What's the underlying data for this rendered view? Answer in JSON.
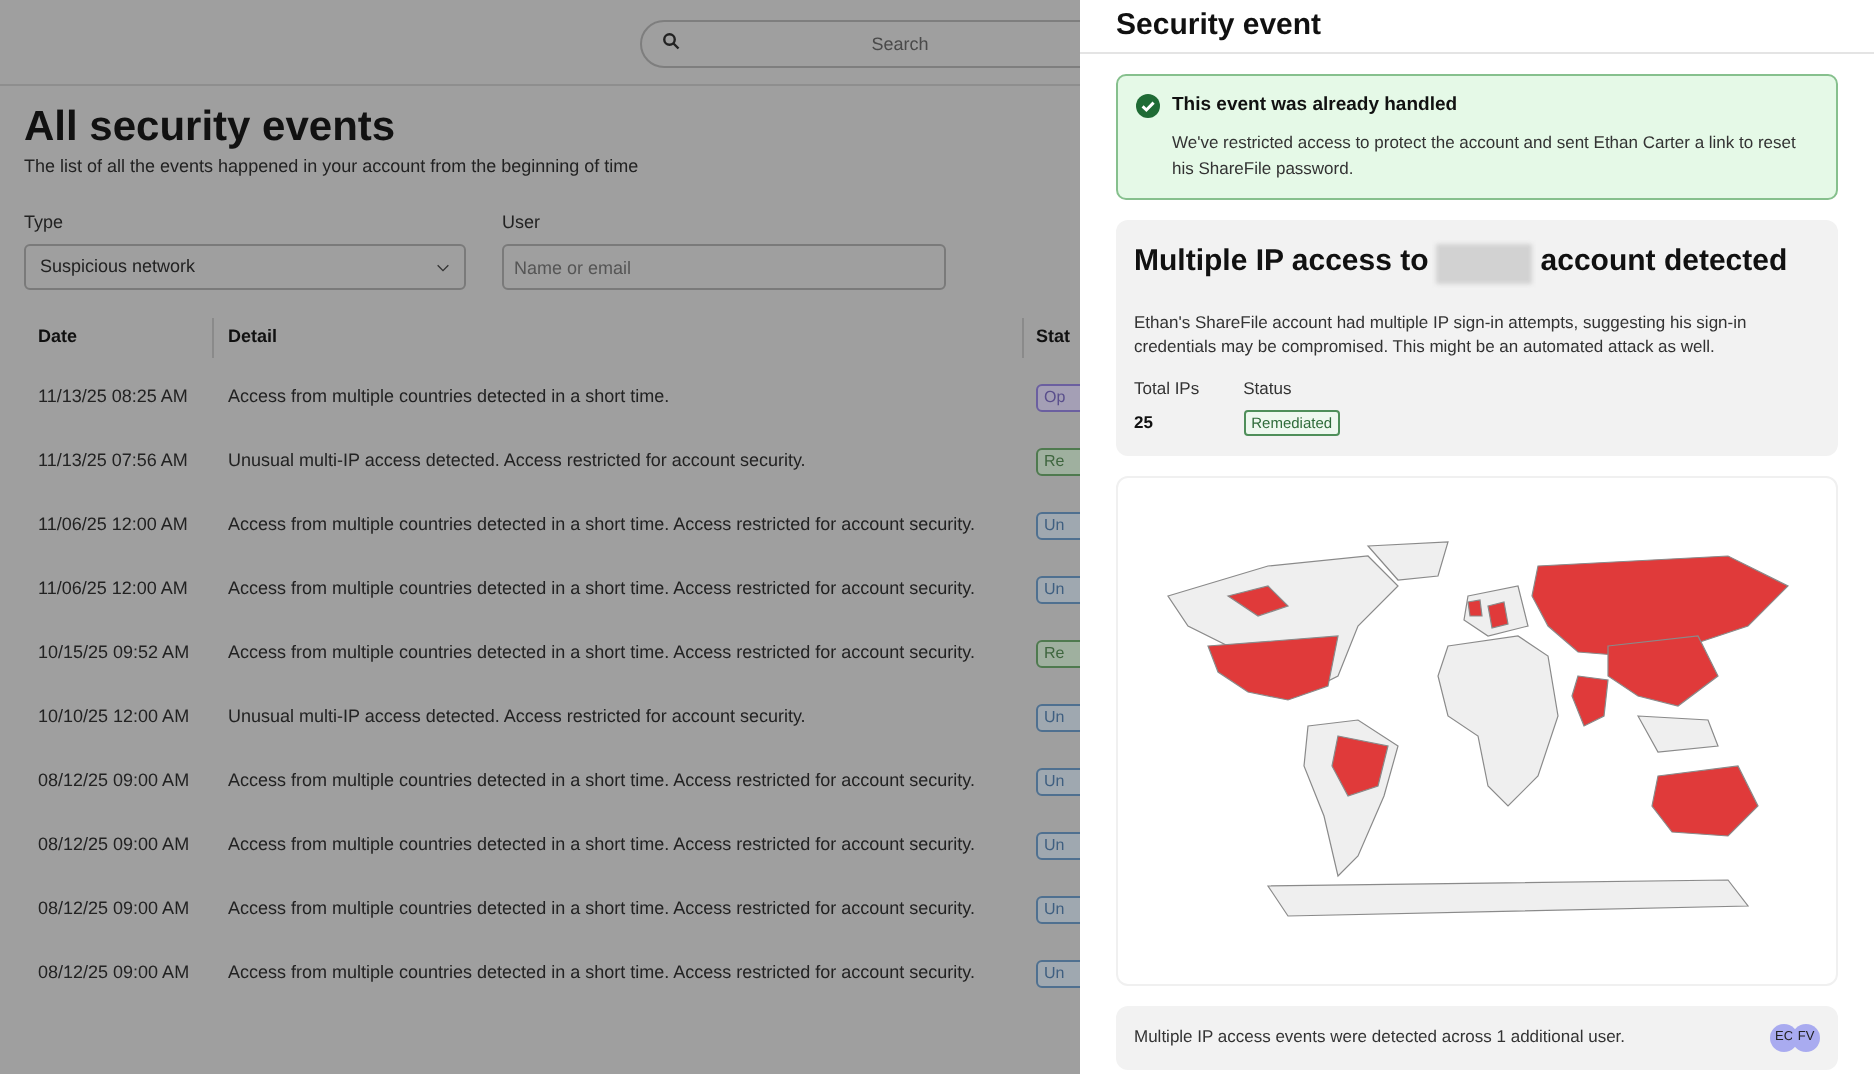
{
  "search": {
    "placeholder": "Search"
  },
  "page": {
    "title": "All security events",
    "subtitle": "The list of all the events happened in your account from the beginning of time"
  },
  "filters": {
    "type": {
      "label": "Type",
      "value": "Suspicious network"
    },
    "user": {
      "label": "User",
      "placeholder": "Name or email"
    }
  },
  "table": {
    "columns": [
      "Date",
      "Detail",
      "Stat"
    ],
    "rows": [
      {
        "date": "11/13/25 08:25 AM",
        "detail": "Access from multiple countries detected in a short time.",
        "status": "Op",
        "kind": "open"
      },
      {
        "date": "11/13/25 07:56 AM",
        "detail": "Unusual multi-IP access detected. Access restricted for account security.",
        "status": "Re",
        "kind": "remediated"
      },
      {
        "date": "11/06/25 12:00 AM",
        "detail": "Access from multiple countries detected in a short time. Access restricted for account security.",
        "status": "Un",
        "kind": "unresolved"
      },
      {
        "date": "11/06/25 12:00 AM",
        "detail": "Access from multiple countries detected in a short time. Access restricted for account security.",
        "status": "Un",
        "kind": "unresolved"
      },
      {
        "date": "10/15/25 09:52 AM",
        "detail": "Access from multiple countries detected in a short time. Access restricted for account security.",
        "status": "Re",
        "kind": "remediated"
      },
      {
        "date": "10/10/25 12:00 AM",
        "detail": "Unusual multi-IP access detected. Access restricted for account security.",
        "status": "Un",
        "kind": "unresolved"
      },
      {
        "date": "08/12/25 09:00 AM",
        "detail": "Access from multiple countries detected in a short time. Access restricted for account security.",
        "status": "Un",
        "kind": "unresolved"
      },
      {
        "date": "08/12/25 09:00 AM",
        "detail": "Access from multiple countries detected in a short time. Access restricted for account security.",
        "status": "Un",
        "kind": "unresolved"
      },
      {
        "date": "08/12/25 09:00 AM",
        "detail": "Access from multiple countries detected in a short time. Access restricted for account security.",
        "status": "Un",
        "kind": "unresolved"
      },
      {
        "date": "08/12/25 09:00 AM",
        "detail": "Access from multiple countries detected in a short time. Access restricted for account security.",
        "status": "Un",
        "kind": "unresolved"
      }
    ]
  },
  "panel": {
    "title": "Security event",
    "alert": {
      "title": "This event was already handled",
      "text": "We've restricted access to protect the account and sent Ethan Carter a link to reset his ShareFile password."
    },
    "event": {
      "title_start": "Multiple IP access to",
      "title_end": "account detected",
      "description": "Ethan's ShareFile account had multiple IP sign-in attempts, suggesting his sign-in credentials may be compromised. This might be an automated attack as well.",
      "stats": [
        {
          "label": "Total IPs",
          "value": "25",
          "kind": "number"
        },
        {
          "label": "Status",
          "value": "Remediated",
          "kind": "badge"
        }
      ]
    },
    "footer": {
      "text": "Multiple IP access events were detected across 1 additional user.",
      "avatars": [
        "EC",
        "FV"
      ]
    }
  }
}
